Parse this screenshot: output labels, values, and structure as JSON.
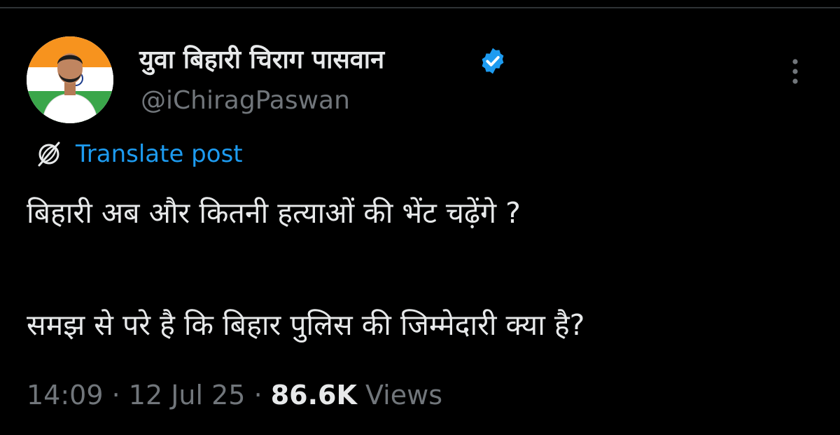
{
  "colors": {
    "background": "#000000",
    "text_primary": "#e7e9ea",
    "text_secondary": "#71767b",
    "accent": "#1d9bf0",
    "divider": "#2f3336"
  },
  "author": {
    "display_name": "युवा बिहारी चिराग पासवान",
    "handle": "@iChiragPaswan",
    "verified": true,
    "verified_icon": "verified-badge-icon",
    "avatar_icon": "profile-photo"
  },
  "menu": {
    "icon": "more-options-icon"
  },
  "translate": {
    "icon": "translate-globe-icon",
    "label": "Translate post"
  },
  "post": {
    "lines": [
      "बिहारी अब और कितनी हत्याओं की भेंट चढ़ेंगे ?",
      "समझ से परे है कि बिहार पुलिस की जिम्मेदारी क्या है?"
    ]
  },
  "meta": {
    "time": "14:09",
    "separator": " · ",
    "date": "12 Jul 25",
    "views_count": "86.6K",
    "views_label": " Views"
  }
}
